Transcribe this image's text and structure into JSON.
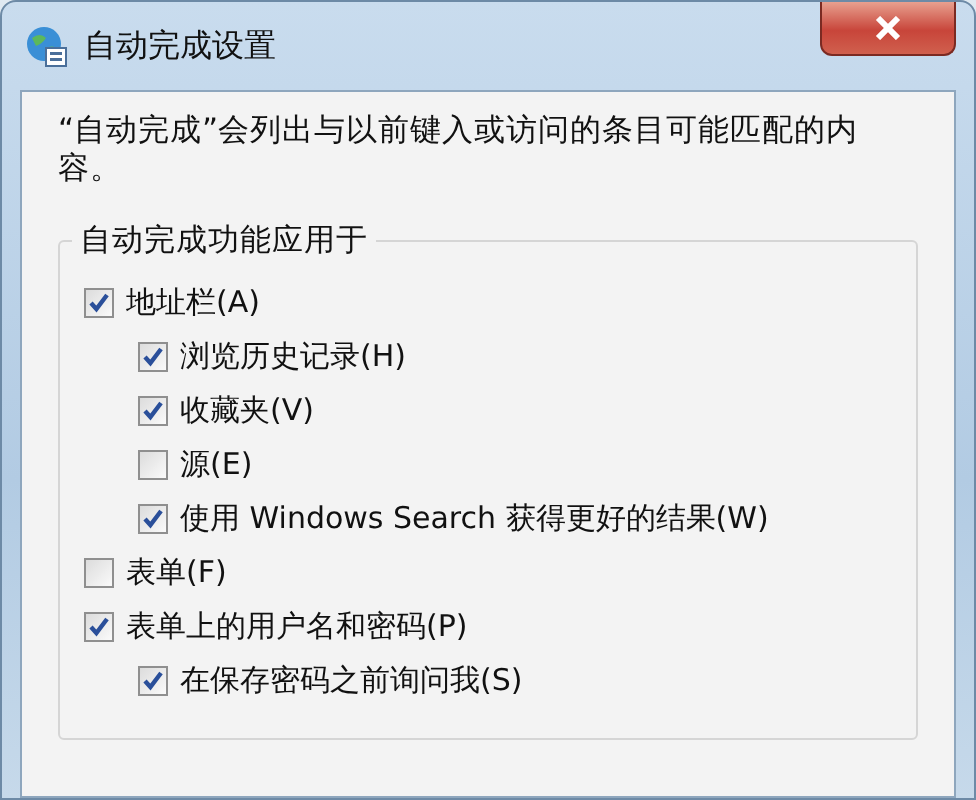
{
  "window": {
    "title": "自动完成设置"
  },
  "description": "“自动完成”会列出与以前键入或访问的条目可能匹配的内容。",
  "group": {
    "title": "自动完成功能应用于",
    "items": [
      {
        "label": "地址栏(A)",
        "checked": true,
        "children": [
          {
            "label": "浏览历史记录(H)",
            "checked": true
          },
          {
            "label": "收藏夹(V)",
            "checked": true
          },
          {
            "label": "源(E)",
            "checked": false
          },
          {
            "label": "使用 Windows Search 获得更好的结果(W)",
            "checked": true
          }
        ]
      },
      {
        "label": "表单(F)",
        "checked": false
      },
      {
        "label": "表单上的用户名和密码(P)",
        "checked": true,
        "children": [
          {
            "label": "在保存密码之前询问我(S)",
            "checked": true
          }
        ]
      }
    ]
  }
}
